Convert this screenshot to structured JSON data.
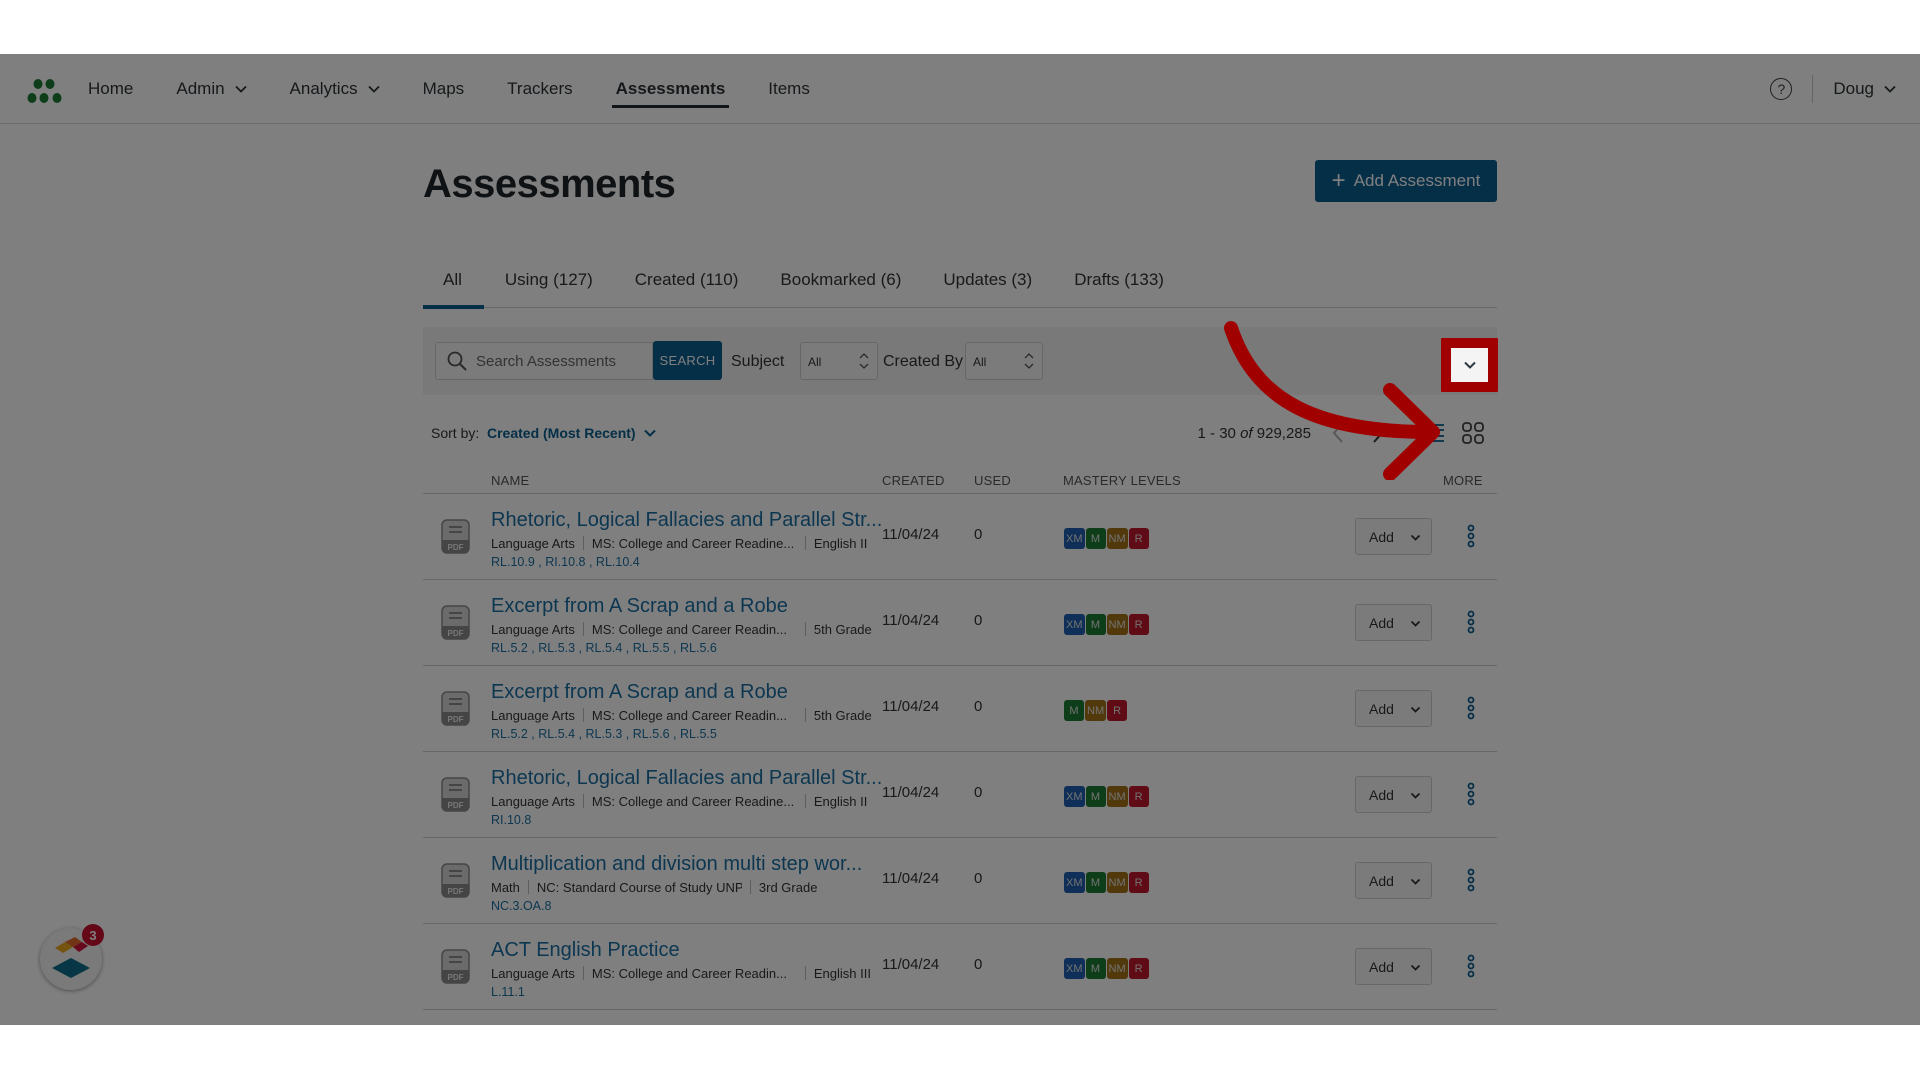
{
  "nav": {
    "items": [
      {
        "label": "Home",
        "dropdown": false,
        "active": false
      },
      {
        "label": "Admin",
        "dropdown": true,
        "active": false
      },
      {
        "label": "Analytics",
        "dropdown": true,
        "active": false
      },
      {
        "label": "Maps",
        "dropdown": false,
        "active": false
      },
      {
        "label": "Trackers",
        "dropdown": false,
        "active": false
      },
      {
        "label": "Assessments",
        "dropdown": false,
        "active": true
      },
      {
        "label": "Items",
        "dropdown": false,
        "active": false
      }
    ],
    "help_icon": "question-circle-icon",
    "help_label": "?",
    "user_name": "Doug"
  },
  "page": {
    "title": "Assessments",
    "add_button_label": "Add Assessment",
    "add_button_icon": "+"
  },
  "tabs": [
    {
      "label": "All",
      "active": true
    },
    {
      "label": "Using (127)",
      "active": false
    },
    {
      "label": "Created (110)",
      "active": false
    },
    {
      "label": "Bookmarked (6)",
      "active": false
    },
    {
      "label": "Updates (3)",
      "active": false
    },
    {
      "label": "Drafts (133)",
      "active": false
    }
  ],
  "filters": {
    "search_placeholder": "Search Assessments",
    "search_value": "",
    "search_button_label": "SEARCH",
    "subject_label": "Subject",
    "subject_value": "All",
    "created_by_label": "Created By",
    "created_by_value": "All"
  },
  "sort": {
    "label": "Sort by:",
    "value": "Created (Most Recent)"
  },
  "pagination": {
    "range": "1 - 30",
    "of": "of",
    "total": "929,285"
  },
  "columns": {
    "name": "NAME",
    "created": "CREATED",
    "used": "USED",
    "mastery": "MASTERY LEVELS",
    "more": "MORE"
  },
  "mastery_colors": {
    "XM": "#1f5fb0",
    "M": "#1d7a34",
    "NM": "#a57219",
    "R": "#c0182c"
  },
  "rows": [
    {
      "title": "Rhetoric, Logical Fallacies and Parallel Str...",
      "subject": "Language Arts",
      "standard_set": "MS: College and Career Readine...",
      "grade": "English II",
      "standards": "RL.10.9 , RI.10.8 , RL.10.4",
      "created": "11/04/24",
      "used": "0",
      "mastery": [
        "XM",
        "M",
        "NM",
        "R"
      ],
      "add_label": "Add"
    },
    {
      "title": "Excerpt from A Scrap and a Robe",
      "subject": "Language Arts",
      "standard_set": "MS: College and Career Readin...",
      "grade": "5th Grade",
      "standards": "RL.5.2 , RL.5.3 , RL.5.4 , RL.5.5 , RL.5.6",
      "created": "11/04/24",
      "used": "0",
      "mastery": [
        "XM",
        "M",
        "NM",
        "R"
      ],
      "add_label": "Add"
    },
    {
      "title": "Excerpt from A Scrap and a Robe",
      "subject": "Language Arts",
      "standard_set": "MS: College and Career Readin...",
      "grade": "5th Grade",
      "standards": "RL.5.2 , RL.5.4 , RL.5.3 , RL.5.6 , RL.5.5",
      "created": "11/04/24",
      "used": "0",
      "mastery": [
        "M",
        "NM",
        "R"
      ],
      "add_label": "Add"
    },
    {
      "title": "Rhetoric, Logical Fallacies and Parallel Str...",
      "subject": "Language Arts",
      "standard_set": "MS: College and Career Readine...",
      "grade": "English II",
      "standards": "RI.10.8",
      "created": "11/04/24",
      "used": "0",
      "mastery": [
        "XM",
        "M",
        "NM",
        "R"
      ],
      "add_label": "Add"
    },
    {
      "title": "Multiplication and division multi step wor...",
      "subject": "Math",
      "standard_set": "NC: Standard Course of Study UNPACK...",
      "grade": "3rd Grade",
      "standards": "NC.3.OA.8",
      "created": "11/04/24",
      "used": "0",
      "mastery": [
        "XM",
        "M",
        "NM",
        "R"
      ],
      "add_label": "Add"
    },
    {
      "title": "ACT English Practice",
      "subject": "Language Arts",
      "standard_set": "MS: College and Career Readin...",
      "grade": "English III",
      "standards": "L.11.1",
      "created": "11/04/24",
      "used": "0",
      "mastery": [
        "XM",
        "M",
        "NM",
        "R"
      ],
      "add_label": "Add"
    }
  ],
  "widget": {
    "badge_count": "3"
  },
  "annotation": {
    "highlight_color": "#a00000",
    "target": "expand-filters-button"
  }
}
